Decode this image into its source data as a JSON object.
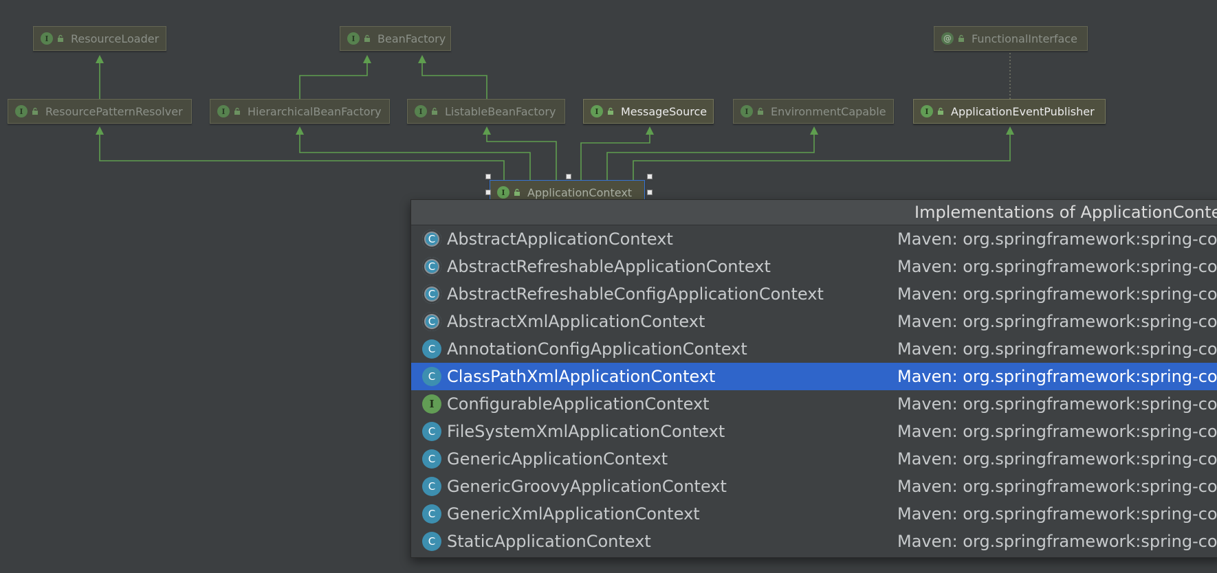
{
  "diagram": {
    "nodes": [
      {
        "id": "ResourceLoader",
        "label": "ResourceLoader",
        "kind": "I"
      },
      {
        "id": "BeanFactory",
        "label": "BeanFactory",
        "kind": "I"
      },
      {
        "id": "FunctionalInterface",
        "label": "FunctionalInterface",
        "kind": "@"
      },
      {
        "id": "ResourcePatternResolver",
        "label": "ResourcePatternResolver",
        "kind": "I"
      },
      {
        "id": "HierarchicalBeanFactory",
        "label": "HierarchicalBeanFactory",
        "kind": "I"
      },
      {
        "id": "ListableBeanFactory",
        "label": "ListableBeanFactory",
        "kind": "I"
      },
      {
        "id": "MessageSource",
        "label": "MessageSource",
        "kind": "I"
      },
      {
        "id": "EnvironmentCapable",
        "label": "EnvironmentCapable",
        "kind": "I"
      },
      {
        "id": "ApplicationEventPublisher",
        "label": "ApplicationEventPublisher",
        "kind": "I"
      },
      {
        "id": "ApplicationContext",
        "label": "ApplicationContext",
        "kind": "I"
      }
    ],
    "edges": [
      {
        "from": "ResourcePatternResolver",
        "to": "ResourceLoader",
        "style": "extends"
      },
      {
        "from": "HierarchicalBeanFactory",
        "to": "BeanFactory",
        "style": "extends"
      },
      {
        "from": "ListableBeanFactory",
        "to": "BeanFactory",
        "style": "extends"
      },
      {
        "from": "ApplicationEventPublisher",
        "to": "FunctionalInterface",
        "style": "annotation"
      },
      {
        "from": "ApplicationContext",
        "to": "ResourcePatternResolver",
        "style": "extends"
      },
      {
        "from": "ApplicationContext",
        "to": "HierarchicalBeanFactory",
        "style": "extends"
      },
      {
        "from": "ApplicationContext",
        "to": "ListableBeanFactory",
        "style": "extends"
      },
      {
        "from": "ApplicationContext",
        "to": "MessageSource",
        "style": "extends"
      },
      {
        "from": "ApplicationContext",
        "to": "EnvironmentCapable",
        "style": "extends"
      },
      {
        "from": "ApplicationContext",
        "to": "ApplicationEventPublisher",
        "style": "extends"
      }
    ],
    "colors": {
      "edge": "#5f9e4f",
      "node_bg": "#4f503f",
      "node_border": "#75765b",
      "interface_badge": "#629d55",
      "class_badge": "#3d8fb0",
      "selection": "#2f65ca"
    }
  },
  "popup": {
    "title": "Implementations of ApplicationContext",
    "rows": [
      {
        "name": "AbstractApplicationContext",
        "location": "Maven: org.springframework:spring-context",
        "icon": "abstract-class-icon",
        "badge": "C"
      },
      {
        "name": "AbstractRefreshableApplicationContext",
        "location": "Maven: org.springframework:spring-context",
        "icon": "abstract-class-icon",
        "badge": "C"
      },
      {
        "name": "AbstractRefreshableConfigApplicationContext",
        "location": "Maven: org.springframework:spring-context",
        "icon": "abstract-class-icon",
        "badge": "C"
      },
      {
        "name": "AbstractXmlApplicationContext",
        "location": "Maven: org.springframework:spring-context",
        "icon": "abstract-class-icon",
        "badge": "C"
      },
      {
        "name": "AnnotationConfigApplicationContext",
        "location": "Maven: org.springframework:spring-context",
        "icon": "class-icon",
        "badge": "C"
      },
      {
        "name": "ClassPathXmlApplicationContext",
        "location": "Maven: org.springframework:spring-context",
        "icon": "class-icon",
        "badge": "C",
        "selected": true
      },
      {
        "name": "ConfigurableApplicationContext",
        "location": "Maven: org.springframework:spring-context",
        "icon": "interface-icon",
        "badge": "I"
      },
      {
        "name": "FileSystemXmlApplicationContext",
        "location": "Maven: org.springframework:spring-context",
        "icon": "class-icon",
        "badge": "C"
      },
      {
        "name": "GenericApplicationContext",
        "location": "Maven: org.springframework:spring-context",
        "icon": "class-icon",
        "badge": "C"
      },
      {
        "name": "GenericGroovyApplicationContext",
        "location": "Maven: org.springframework:spring-context",
        "icon": "class-icon",
        "badge": "C"
      },
      {
        "name": "GenericXmlApplicationContext",
        "location": "Maven: org.springframework:spring-context",
        "icon": "class-icon",
        "badge": "C"
      },
      {
        "name": "StaticApplicationContext",
        "location": "Maven: org.springframework:spring-context",
        "icon": "class-icon",
        "badge": "C"
      }
    ]
  }
}
